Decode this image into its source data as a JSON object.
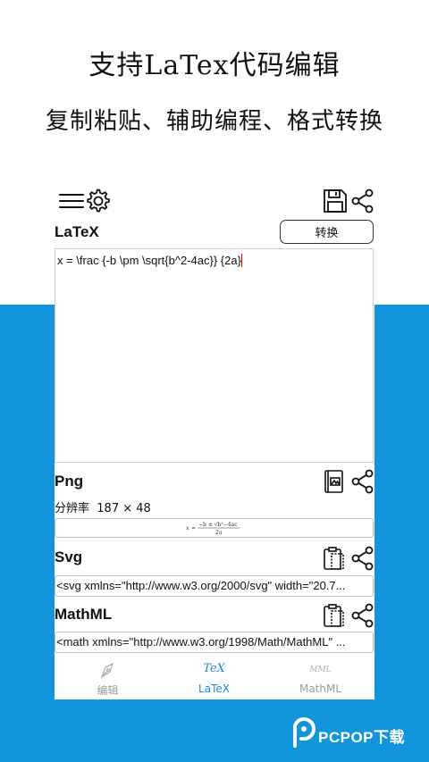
{
  "headline": {
    "line1": "支持LaTex代码编辑",
    "line2": "复制粘贴、辅助编程、格式转换"
  },
  "colors": {
    "band": "#1296db",
    "accent": "#1e88e5",
    "caret": "#d00000"
  },
  "toolbar": {
    "icons": [
      "menu-icon",
      "settings-icon",
      "save-icon",
      "share-icon"
    ]
  },
  "latex": {
    "title": "LaTeX",
    "convert_label": "转换",
    "input": "x = \\frac {-b \\pm \\sqrt{b^2-4ac}} {2a}"
  },
  "png": {
    "title": "Png",
    "resolution_label": "分辨率",
    "resolution_value": "187 × 48",
    "preview": {
      "x": "x",
      "eq": "=",
      "numerator": "−b ± √b²−4ac",
      "denominator": "2a"
    }
  },
  "svg": {
    "title": "Svg",
    "code": "<svg xmlns=\"http://www.w3.org/2000/svg\" width=\"20.7..."
  },
  "mathml": {
    "title": "MathML",
    "code": "<math xmlns=\"http://www.w3.org/1998/Math/MathML\" ..."
  },
  "nav": {
    "items": [
      {
        "label": "编辑",
        "icon": "pen-icon",
        "active": false
      },
      {
        "label": "LaTeX",
        "glyph": "TeX",
        "active": true
      },
      {
        "label": "MathML",
        "glyph": "MML",
        "active": false
      }
    ]
  },
  "watermark": {
    "text": "PCPOP下载"
  }
}
